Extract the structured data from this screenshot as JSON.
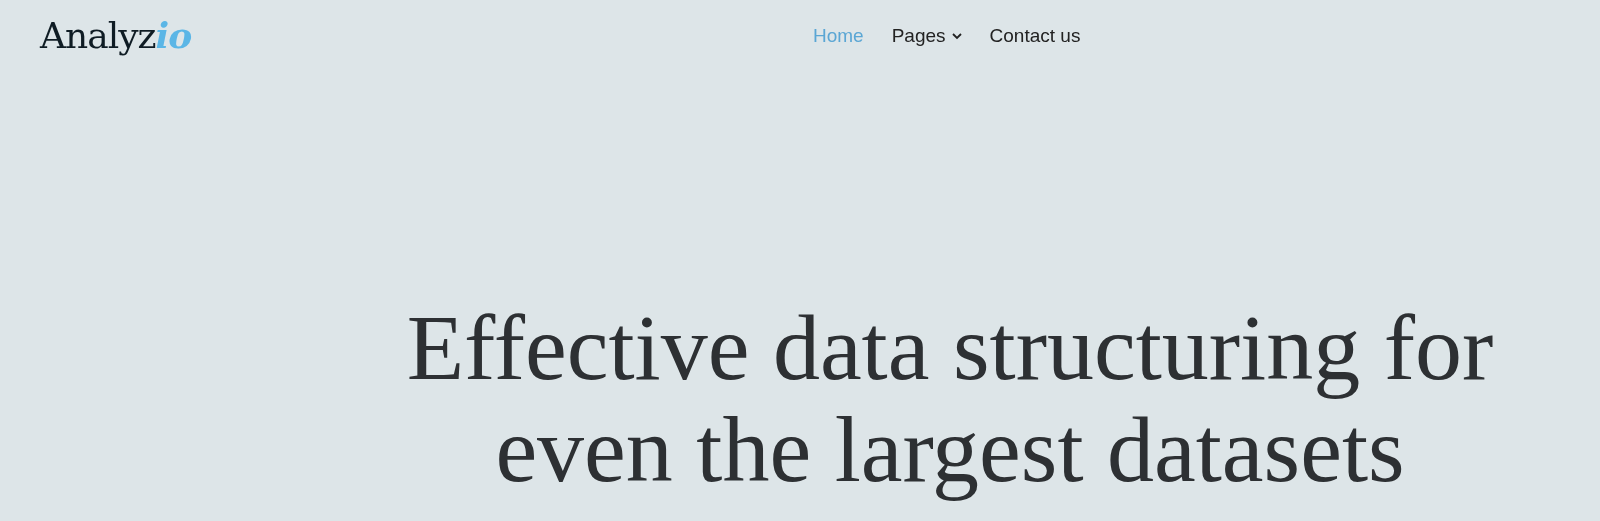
{
  "logo": {
    "text": "Analyz",
    "accent": "io"
  },
  "nav": [
    {
      "label": "Home",
      "selected": true,
      "dropdown": false
    },
    {
      "label": "Pages",
      "selected": false,
      "dropdown": true
    },
    {
      "label": "Contact us",
      "selected": false,
      "dropdown": false
    }
  ],
  "hero": {
    "headline": "Effective data structuring for even the largest datasets"
  }
}
